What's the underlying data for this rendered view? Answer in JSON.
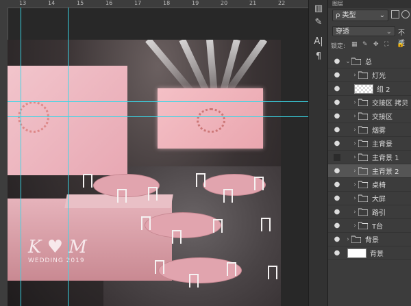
{
  "ruler": {
    "ticks": [
      "13",
      "14",
      "15",
      "16",
      "17",
      "18",
      "19",
      "20",
      "21",
      "22"
    ]
  },
  "toolbar": {
    "tools": [
      {
        "name": "character-tool",
        "glyph": "A|"
      },
      {
        "name": "paragraph-tool",
        "glyph": "¶"
      }
    ]
  },
  "panel": {
    "tabs": "图层",
    "filter": {
      "label": "ρ 类型",
      "arrow": "⌄"
    },
    "blend": {
      "value": "穿透",
      "opacity_label": "不透"
    },
    "lock": {
      "label": "锁定:"
    }
  },
  "layers": [
    {
      "name": "总",
      "indent": 0,
      "type": "group-open",
      "visible": true
    },
    {
      "name": "灯光",
      "indent": 1,
      "type": "group",
      "visible": true
    },
    {
      "name": "组 2",
      "indent": 1,
      "type": "pixel-checker",
      "visible": true
    },
    {
      "name": "交接区 拷贝",
      "indent": 1,
      "type": "group",
      "visible": true
    },
    {
      "name": "交接区",
      "indent": 1,
      "type": "group",
      "visible": true
    },
    {
      "name": "烟雾",
      "indent": 1,
      "type": "group",
      "visible": true
    },
    {
      "name": "主背景",
      "indent": 1,
      "type": "group",
      "visible": true
    },
    {
      "name": "主背景 1",
      "indent": 1,
      "type": "group",
      "visible": false
    },
    {
      "name": "主背景 2",
      "indent": 1,
      "type": "group",
      "visible": true,
      "selected": true
    },
    {
      "name": "桌椅",
      "indent": 1,
      "type": "group",
      "visible": true
    },
    {
      "name": "大屏",
      "indent": 1,
      "type": "group",
      "visible": true
    },
    {
      "name": "路引",
      "indent": 1,
      "type": "group",
      "visible": true
    },
    {
      "name": "T台",
      "indent": 1,
      "type": "group",
      "visible": true
    },
    {
      "name": "背景",
      "indent": 0,
      "type": "group",
      "visible": true
    },
    {
      "name": "背景",
      "indent": 0,
      "type": "pixel-white",
      "visible": true
    }
  ],
  "canvas": {
    "script_text": "K ♥ M",
    "script_sub": "WEDDING 2019"
  },
  "colors": {
    "guide": "#3ad6e6",
    "accent_pink": "#e8a8b3"
  }
}
